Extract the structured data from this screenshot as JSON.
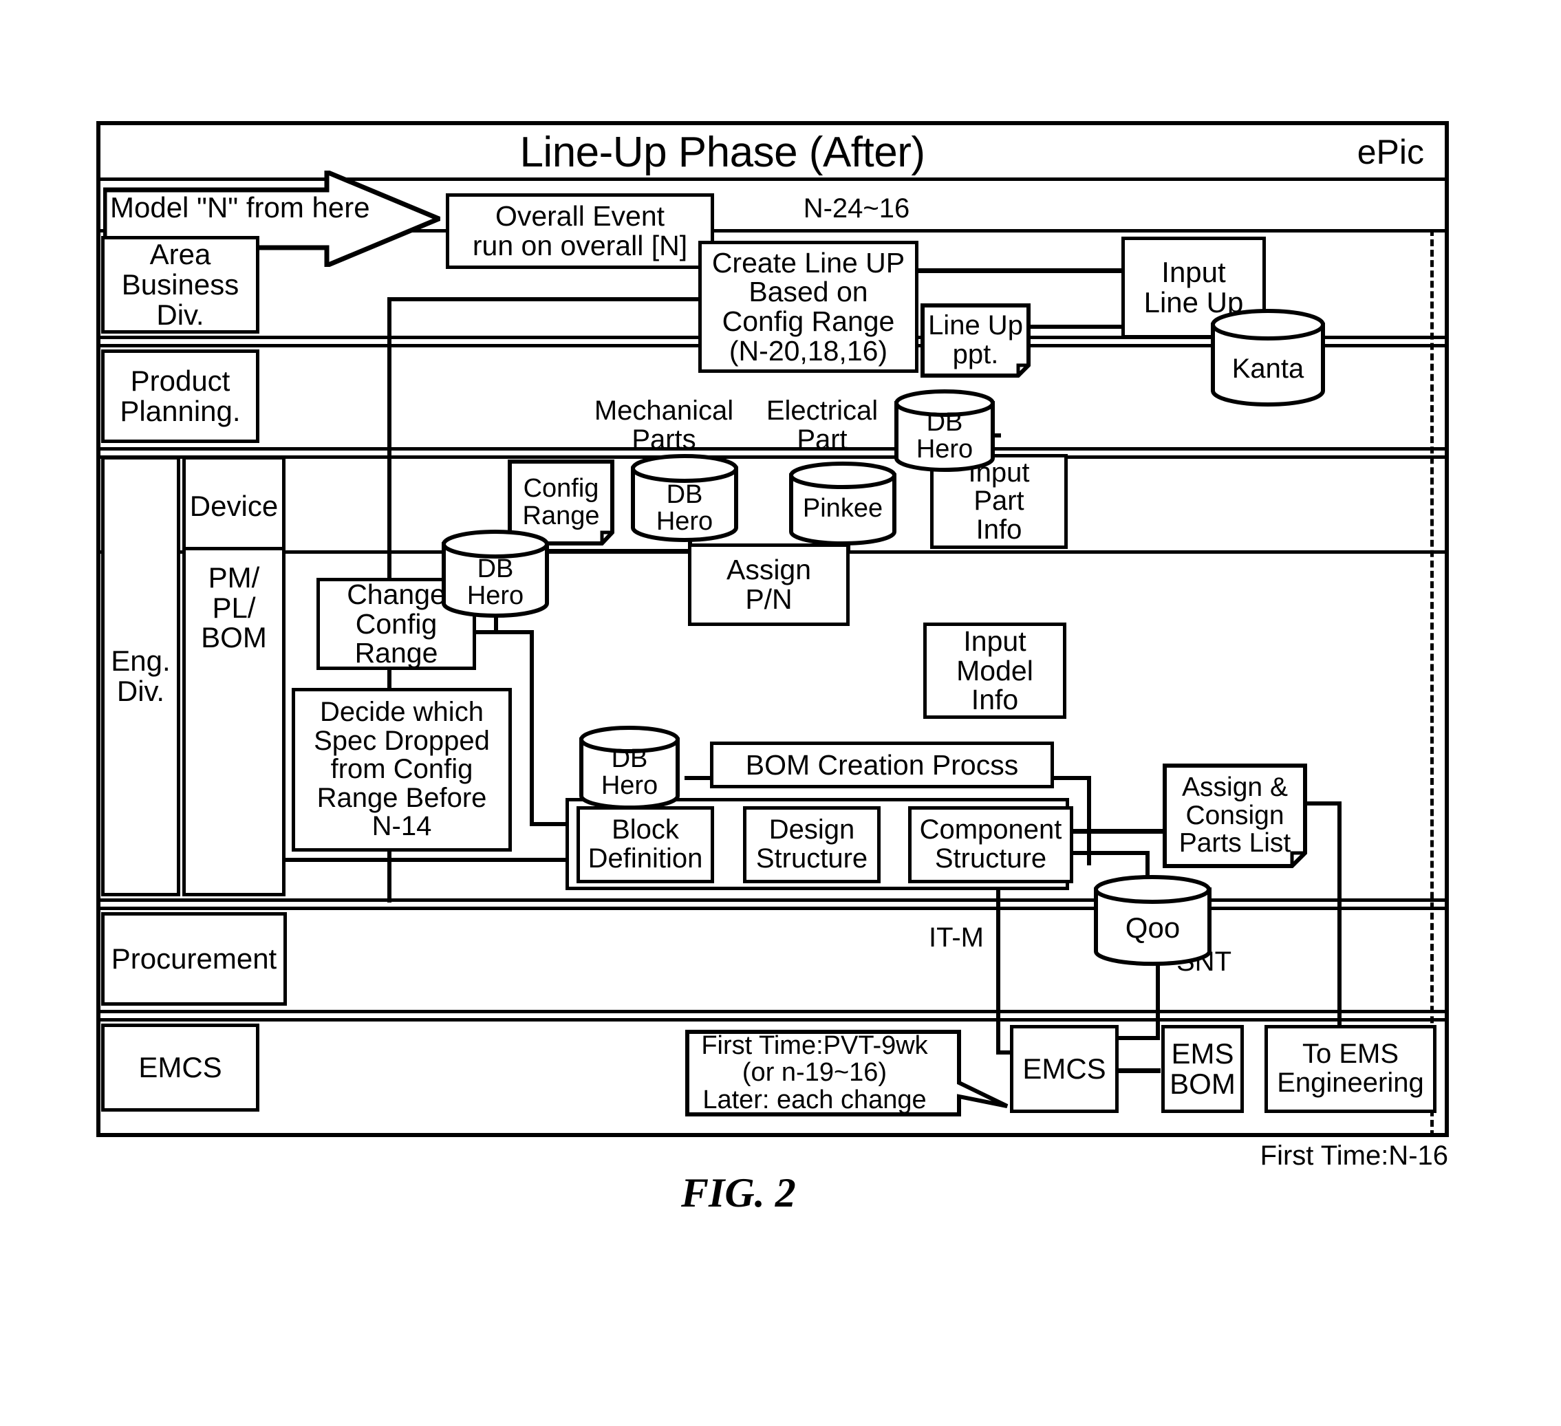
{
  "figure": {
    "caption": "FIG. 2",
    "system_tag": "ePic",
    "title": "Line-Up Phase (After)",
    "footer_note": "First Time:N-16"
  },
  "timeline": {
    "model_start": "Model \"N\" from here",
    "phase_range": "N-24~16"
  },
  "swimlanes": [
    {
      "name": "Area Business Div.",
      "label": "Area\nBusiness\nDiv."
    },
    {
      "name": "Product Planning",
      "label": "Product\nPlanning."
    },
    {
      "name": "Eng Div",
      "label": "Eng.\nDiv."
    },
    {
      "name": "Device",
      "label": "Device"
    },
    {
      "name": "PM/PL/BOM",
      "label": "PM/\nPL/\nBOM"
    },
    {
      "name": "Procurement",
      "label": "Procurement"
    },
    {
      "name": "EMCS",
      "label": "EMCS"
    }
  ],
  "nodes": {
    "overall_event": "Overall Event\nrun on overall [N]",
    "create_line_up": "Create Line UP\nBased on\nConfig Range\n(N-20,18,16)",
    "line_up_ppt": "Line Up\nppt.",
    "input_line_up": "Input\nLine Up",
    "kanta": "Kanta",
    "mechanical_parts": "Mechanical\nParts",
    "electrical_part": "Electrical\nPart",
    "db_hero_top": "DB\nHero",
    "config_range": "Config\nRange",
    "db_hero_mech": "DB\nHero",
    "pinkee": "Pinkee",
    "input_part_info": "Input\nPart\nInfo",
    "db_hero_left": "DB\nHero",
    "assign_pn": "Assign\nP/N",
    "change_config_range": "Change\nConfig\nRange",
    "decide_spec": "Decide which\nSpec Dropped\nfrom Config\nRange Before\nN-14",
    "input_model_info": "Input\nModel\nInfo",
    "db_hero_bom": "DB\nHero",
    "bom_creation": "BOM Creation Procss",
    "block_definition": "Block\nDefinition",
    "design_structure": "Design\nStructure",
    "component_structure": "Component\nStructure",
    "assign_consign": "Assign &\nConsign\nParts List",
    "qoo": "Qoo",
    "it_m": "IT-M",
    "snt": "SNT",
    "first_time_note": "First Time:PVT-9wk\n(or n-19~16)\nLater: each change",
    "emcs_node": "EMCS",
    "ems_bom": "EMS\nBOM",
    "to_ems_engineering": "To EMS\nEngineering"
  },
  "colors": {
    "ink": "#000000",
    "paper": "#ffffff"
  }
}
